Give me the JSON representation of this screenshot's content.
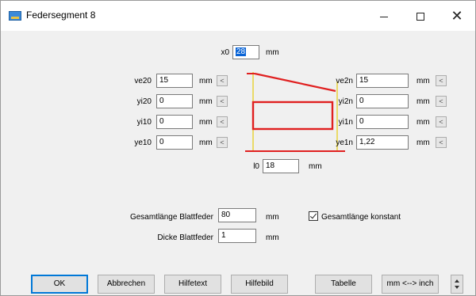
{
  "window": {
    "title": "Federsegment 8",
    "minimize_label": "—",
    "maximize_label": "☐",
    "close_label": "✕"
  },
  "x0": {
    "label": "x0",
    "value": "28",
    "unit": "mm"
  },
  "left": [
    {
      "label": "ve20",
      "value": "15",
      "unit": "mm",
      "btn": "<"
    },
    {
      "label": "yi20",
      "value": "0",
      "unit": "mm",
      "btn": "<"
    },
    {
      "label": "yi10",
      "value": "0",
      "unit": "mm",
      "btn": "<"
    },
    {
      "label": "ye10",
      "value": "0",
      "unit": "mm",
      "btn": "<"
    }
  ],
  "right": [
    {
      "label": "ve2n",
      "value": "15",
      "unit": "mm",
      "btn": "<"
    },
    {
      "label": "yi2n",
      "value": "0",
      "unit": "mm",
      "btn": "<"
    },
    {
      "label": "yi1n",
      "value": "0",
      "unit": "mm",
      "btn": "<"
    },
    {
      "label": "ye1n",
      "value": "1,22",
      "unit": "mm",
      "btn": "<"
    }
  ],
  "l0": {
    "label": "l0",
    "value": "18",
    "unit": "mm"
  },
  "gesamtlaenge": {
    "label": "Gesamtlänge Blattfeder",
    "value": "80",
    "unit": "mm"
  },
  "dicke": {
    "label": "Dicke Blattfeder",
    "value": "1",
    "unit": "mm"
  },
  "konstant": {
    "label": "Gesamtlänge konstant",
    "checked": true
  },
  "buttons": {
    "ok": "OK",
    "abbrechen": "Abbrechen",
    "hilfetext": "Hilfetext",
    "hilfebild": "Hilfebild",
    "tabelle": "Tabelle",
    "mm_inch": "mm <--> inch"
  },
  "colors": {
    "spring": "#e02020",
    "guide": "#e8d23a",
    "accent": "#0078d7"
  }
}
